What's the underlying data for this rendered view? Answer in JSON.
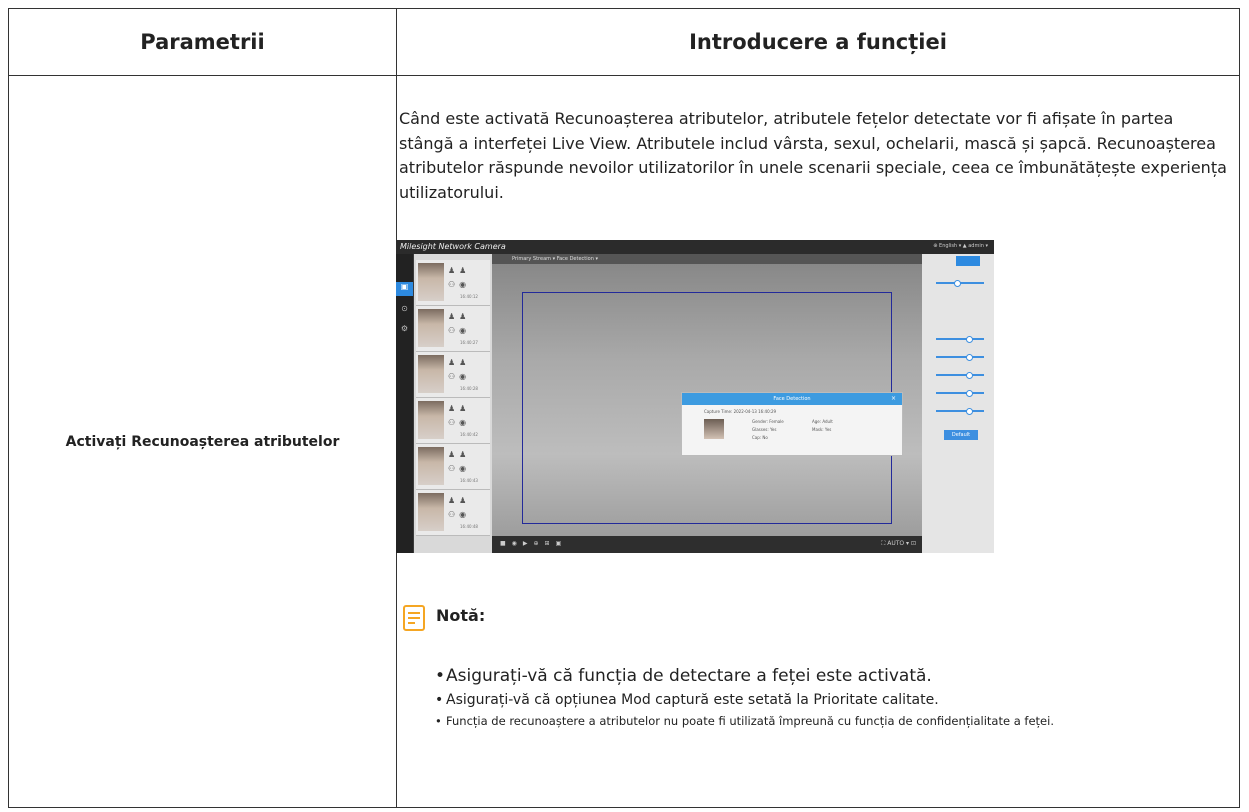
{
  "table": {
    "headers": [
      "Parametrii",
      "Introducere a funcției"
    ],
    "row": {
      "parameter": "Activați Recunoașterea atributelor",
      "description": "Când este activată Recunoașterea atributelor, atributele fețelor detectate vor fi afișate în partea stângă a interfeței Live View. Atributele includ vârsta, sexul, ochelarii, mască și șapcă. Recunoașterea atributelor răspunde nevoilor utilizatorilor în unele scenarii speciale, ceea ce îmbunătățește experiența utilizatorului."
    }
  },
  "screenshot": {
    "logo": "Milesight Network Camera",
    "top_right": "⊕ English ▾    ▲ admin ▾",
    "stream_select": "Primary Stream ▾     Face Detection ▾",
    "dialog": {
      "title": "Face Detection",
      "close": "×",
      "capture_time": "Capture Time: 2022-04-13 16:40:29",
      "gender": "Gender: Female",
      "age": "Age: Adult",
      "glasses": "Glasses: Yes",
      "mask": "Mask: Yes",
      "cap": "Cap: No"
    },
    "face_times": [
      "16:40:12",
      "16:40:27",
      "16:40:28",
      "16:40:42",
      "16:40:43",
      "16:40:48"
    ],
    "bottom_right": "⛶ AUTO ▾ ⊡",
    "default_button": "Default"
  },
  "note": {
    "title": "Notă:",
    "icon": "note-icon",
    "items": [
      "Asigurați-vă că funcția de detectare a feței este activată.",
      "Asigurați-vă că opțiunea Mod captură este setată la Prioritate calitate.",
      "Funcția de recunoaștere a atributelor nu poate fi utilizată împreună cu funcția de confidențialitate a feței."
    ]
  },
  "colors": {
    "border": "#333333",
    "note_icon": "#f5a623",
    "dialog_header": "#3d9be0",
    "roi_box": "#232a9a"
  }
}
